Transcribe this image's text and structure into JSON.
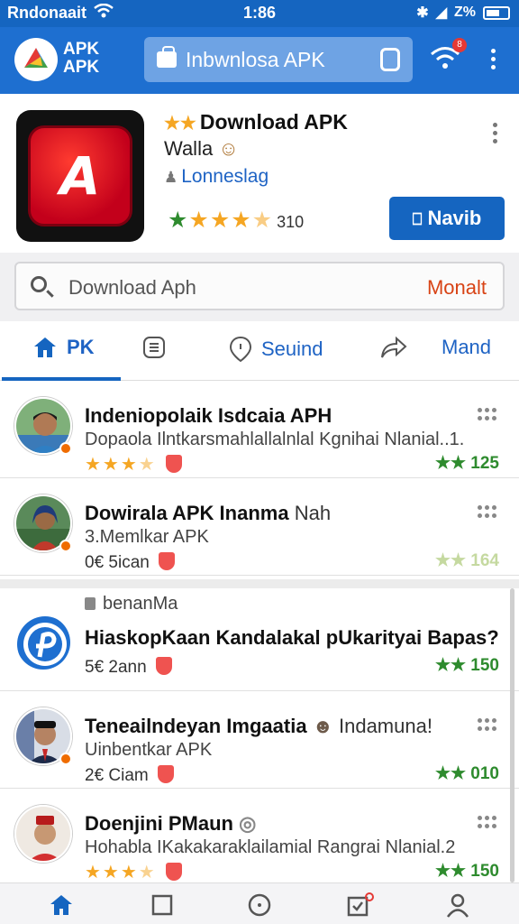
{
  "status_bar": {
    "carrier": "Rndonaait",
    "time": "1:86",
    "battery": "Z%"
  },
  "app_bar": {
    "logo_line1": "APK",
    "logo_line2": "APK",
    "search_label": "Inbwnlosa APK",
    "notification_badge": "8"
  },
  "app_card": {
    "title": "Download APK",
    "subtitle": "Walla",
    "developer": "Lonneslag",
    "rating_count": "310",
    "rating_value": 4.5,
    "icon_letter": "A",
    "install_label": "Navib"
  },
  "search": {
    "placeholder": "Download Aph",
    "action_label": "Monalt"
  },
  "tabs": [
    {
      "label": "PK",
      "icon": "home-icon",
      "active": true
    },
    {
      "label": "",
      "icon": "list-icon",
      "active": false
    },
    {
      "label": "Seuind",
      "icon": "location-pin-icon",
      "active": false
    },
    {
      "label": "",
      "icon": "share-arrow-icon",
      "active": false
    },
    {
      "label": "Mand",
      "icon": "",
      "active": false
    }
  ],
  "list": {
    "section_note": "benanMa",
    "items": [
      {
        "title": "Indeniopolaik Isdcaia APH",
        "title_extra": "",
        "subtitle": "Dopaola Ilntkarsmahlallalnlal Kgnihai Nlanial..1.",
        "stars": 3.5,
        "meta": "",
        "count": "125"
      },
      {
        "title": "Dowirala APK Inanma",
        "title_extra": "Nah",
        "subtitle": "3.Memlkar APK",
        "stars": 0,
        "meta": "0€ 5ican",
        "count": "164"
      },
      {
        "title": "HiaskopKaan Kandalakal pUkarityai Bapas?",
        "title_extra": "",
        "subtitle": "",
        "stars": 0,
        "meta": "5€ 2ann",
        "count": "150"
      },
      {
        "title": "Teneailndeyan Imgaatia",
        "title_extra": "Indamuna!",
        "subtitle": "Uinbentkar APK",
        "stars": 0,
        "meta": "2€ Ciam",
        "count": "010"
      },
      {
        "title": "Doenjini PMaun",
        "title_extra": "",
        "subtitle": "Hohabla IKakakaraklailamial Rangrai Nlanial.2",
        "stars": 3.5,
        "meta": "",
        "count": "150"
      }
    ]
  },
  "bottom_nav": [
    "home-icon",
    "square-icon",
    "clock-icon",
    "calendar-check-icon",
    "profile-icon"
  ],
  "colors": {
    "primary": "#1e6fd0",
    "accent": "#d84315",
    "green": "#2e8b2e",
    "star": "#f5a623"
  }
}
